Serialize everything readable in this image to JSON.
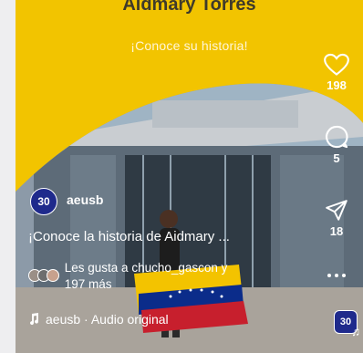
{
  "colors": {
    "brand_yellow": "#f2c400",
    "brand_blue": "#1f2a8c",
    "text_white": "#ffffff"
  },
  "banner": {
    "name": "Aidmary Torres",
    "subtitle": "¡Conoce su historia!"
  },
  "actions": {
    "likes": {
      "icon": "heart-icon",
      "count": "198"
    },
    "comments": {
      "icon": "comment-icon",
      "count": "5"
    },
    "shares": {
      "icon": "send-icon",
      "count": "18"
    },
    "more": {
      "icon": "more-icon"
    }
  },
  "post": {
    "badge": "30",
    "username": "aeusb",
    "caption": "¡Conoce la historia de Aidmary ...",
    "likes_line1": "Les gusta a chucho_gascon y",
    "likes_line2": "197 más",
    "audio": "aeusb · Audio original"
  }
}
